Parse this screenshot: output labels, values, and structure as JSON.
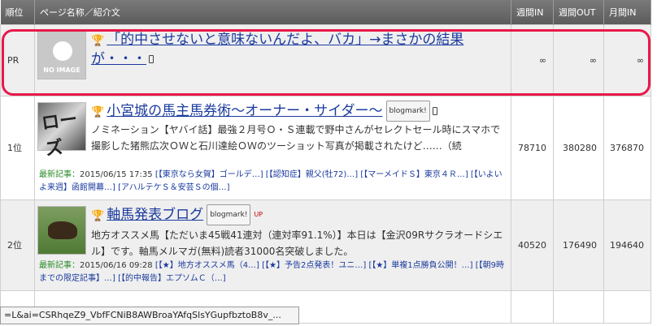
{
  "header": {
    "rank": "順位",
    "name": "ページ名称／紹介文",
    "week_in": "週間IN",
    "week_out": "週間OUT",
    "month_in": "月間IN"
  },
  "rows": {
    "pr": {
      "rank": "PR",
      "thumb_label": "NO IMAGE",
      "title": "「的中させないと意味ないんだよ、バカ」→まさかの結果が・・・",
      "week_in": "∞",
      "week_out": "∞",
      "month_in": "∞"
    },
    "r1": {
      "rank": "1位",
      "thumb_text": "ローズ",
      "title": "小宮城の馬主馬券術〜オーナー・サイダー〜",
      "badge": "blogmark!",
      "desc": "ノミネーション【ヤバイ話】最強２月号Ｏ・Ｓ連載で野中さんがセレクトセール時にスマホで撮影した猪熊広次ＯＷと石川達絵ＯＷのツーショット写真が掲載されたけど……（続",
      "latest_label": "最新記事：",
      "latest_date": "2015/06/15 17:35",
      "latest_links": "[【東京なら女賀】ゴールデ…] [【認知症】親父(牡72)…] [【マーメイドＳ】東京４Ｒ…] [【いよいよ来週】函館開幕…] [アハルテケＳ＆安芸Ｓの個…]",
      "week_in": "78710",
      "week_out": "380280",
      "month_in": "376870"
    },
    "r2": {
      "rank": "2位",
      "title": "軸馬発表ブログ",
      "badge": "blogmark!",
      "up": "UP",
      "desc": "地方オススメ馬【ただいま45戦41連対（連対率91.1%）】本日は【金沢09Rサクラオードシエル】です。軸馬メルマガ(無料)読者31000名突破しました。",
      "latest_label": "最新記事：",
      "latest_date": "2015/06/16 09:28",
      "latest_links": "[【★】地方オススメ馬（4…] [【★】予告2点発表！ユニ…] [【★】単複1点勝負公開！…] [【朝9時までの限定記事】…] [【的中報告】エプソムＣ（…]",
      "week_in": "40520",
      "week_out": "176490",
      "month_in": "194640"
    },
    "r3": {
      "rank": "",
      "week_in": "",
      "week_out": "",
      "month_in": ""
    }
  },
  "status_url": "=L&ai=CSRhqeZ9_VbfFCNiB8AWBroaYAfqSlsYGupfbztoB8v_..."
}
